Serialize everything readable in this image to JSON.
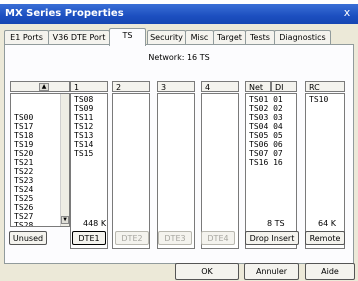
{
  "window": {
    "title": "MX Series Properties",
    "close_glyph": "x"
  },
  "tabs": [
    {
      "label": "E1 Ports"
    },
    {
      "label": "V36 DTE Port"
    },
    {
      "label": "TS"
    },
    {
      "label": "Security"
    },
    {
      "label": "Misc"
    },
    {
      "label": "Target"
    },
    {
      "label": "Tests"
    },
    {
      "label": "Diagnostics"
    }
  ],
  "active_tab": "TS",
  "network_label": "Network: 16 TS",
  "available_list": [
    "TS00",
    "TS17",
    "TS18",
    "TS19",
    "TS20",
    "TS21",
    "TS22",
    "TS23",
    "TS24",
    "TS25",
    "TS26",
    "TS27",
    "TS28"
  ],
  "dte_columns": [
    {
      "header": "1",
      "items": [
        "TS08",
        "TS09",
        "TS11",
        "TS12",
        "TS13",
        "TS14",
        "TS15"
      ]
    },
    {
      "header": "2",
      "items": []
    },
    {
      "header": "3",
      "items": []
    },
    {
      "header": "4",
      "items": []
    }
  ],
  "net_dl": {
    "headers": [
      "Net",
      "DI"
    ],
    "rows": [
      [
        "TS01",
        "01"
      ],
      [
        "TS02",
        "02"
      ],
      [
        "TS03",
        "03"
      ],
      [
        "TS04",
        "04"
      ],
      [
        "TS05",
        "05"
      ],
      [
        "TS06",
        "06"
      ],
      [
        "TS07",
        "07"
      ],
      [
        "TS16",
        "16"
      ]
    ]
  },
  "rc": {
    "header": "RC",
    "items": [
      "TS10"
    ]
  },
  "summary": {
    "dte1": "448 K",
    "drop_insert": "8 TS",
    "remote": "64 K"
  },
  "row_buttons": {
    "unused": "Unused",
    "dte1": "DTE1",
    "dte2": "DTE2",
    "dte3": "DTE3",
    "dte4": "DTE4",
    "drop_insert": "Drop Insert",
    "remote": "Remote"
  },
  "dialog_buttons": {
    "ok": "OK",
    "cancel": "Annuler",
    "help": "Aide"
  }
}
